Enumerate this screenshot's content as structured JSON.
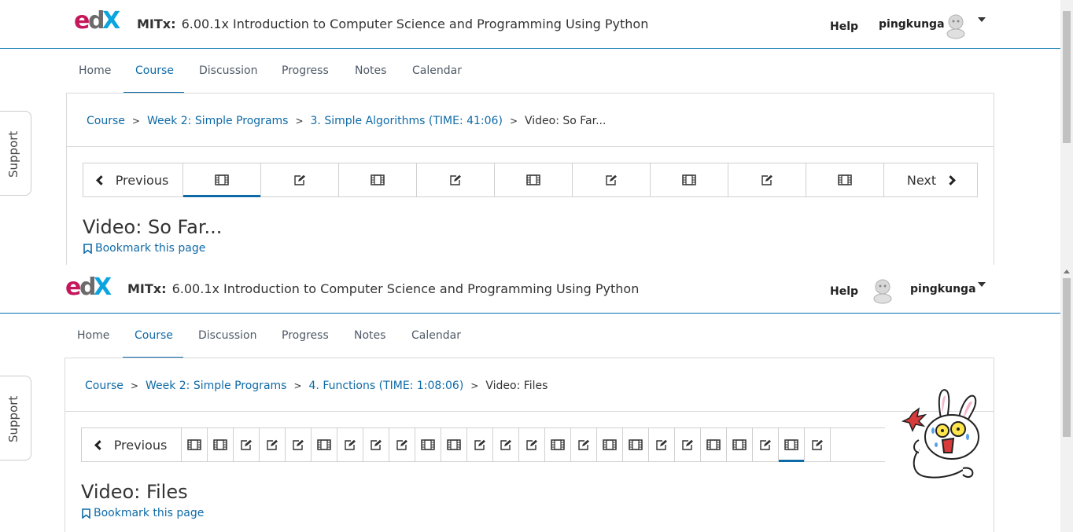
{
  "icons": {
    "video": "film-icon",
    "problem": "pencil-square-icon",
    "bookmark": "bookmark-icon",
    "prev": "chevron-left-icon",
    "next": "chevron-right-icon",
    "caret": "caret-down-icon"
  },
  "colors": {
    "link_blue": "#0e6aa7",
    "header_rule": "#0075b4",
    "edx_red": "#c4175c",
    "edx_blue": "#0aa4e1"
  },
  "top": {
    "header": {
      "course_org": "MITx:",
      "course_name": "6.00.1x Introduction to Computer Science and Programming Using Python",
      "help": "Help",
      "username": "pingkunga"
    },
    "tabs": [
      "Home",
      "Course",
      "Discussion",
      "Progress",
      "Notes",
      "Calendar"
    ],
    "active_tab": "Course",
    "breadcrumb": {
      "course": "Course",
      "section": "Week 2: Simple Programs",
      "subsection": "3. Simple Algorithms (TIME: 41:06)",
      "current": "Video: So Far..."
    },
    "seqnav": {
      "previous": "Previous",
      "next": "Next",
      "items": [
        "video",
        "problem",
        "video",
        "problem",
        "video",
        "problem",
        "video",
        "problem",
        "video"
      ],
      "active_index": 0
    },
    "unit_title": "Video: So Far...",
    "bookmark": "Bookmark this page",
    "support": "Support"
  },
  "bottom": {
    "header": {
      "course_org": "MITx:",
      "course_name": "6.00.1x Introduction to Computer Science and Programming Using Python",
      "help": "Help",
      "username": "pingkunga"
    },
    "tabs": [
      "Home",
      "Course",
      "Discussion",
      "Progress",
      "Notes",
      "Calendar"
    ],
    "active_tab": "Course",
    "breadcrumb": {
      "course": "Course",
      "section": "Week 2: Simple Programs",
      "subsection": "4. Functions (TIME: 1:08:06)",
      "current": "Video: Files"
    },
    "seqnav": {
      "previous": "Previous",
      "items": [
        "video",
        "video",
        "problem",
        "problem",
        "problem",
        "video",
        "problem",
        "problem",
        "problem",
        "video",
        "video",
        "problem",
        "problem",
        "problem",
        "video",
        "problem",
        "video",
        "video",
        "problem",
        "problem",
        "video",
        "video",
        "problem",
        "video",
        "problem"
      ],
      "active_index": 23
    },
    "unit_title": "Video: Files",
    "bookmark": "Bookmark this page",
    "support": "Support"
  }
}
